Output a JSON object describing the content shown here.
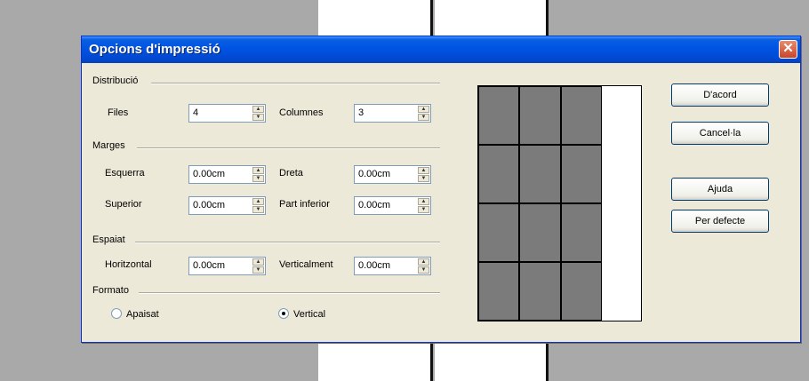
{
  "dialog": {
    "title": "Opcions d'impressió",
    "close_label": "✕"
  },
  "groups": {
    "distribucio": {
      "label": "Distribució",
      "files": {
        "label": "Files",
        "value": "4"
      },
      "columnes": {
        "label": "Columnes",
        "value": "3"
      }
    },
    "marges": {
      "label": "Marges",
      "esquerra": {
        "label": "Esquerra",
        "value": "0.00cm"
      },
      "dreta": {
        "label": "Dreta",
        "value": "0.00cm"
      },
      "superior": {
        "label": "Superior",
        "value": "0.00cm"
      },
      "part_inferior": {
        "label": "Part inferior",
        "value": "0.00cm"
      }
    },
    "espaiat": {
      "label": "Espaiat",
      "horitzontal": {
        "label": "Horitzontal",
        "value": "0.00cm"
      },
      "verticalment": {
        "label": "Verticalment",
        "value": "0.00cm"
      }
    },
    "formato": {
      "label": "Formato",
      "apaisat": {
        "label": "Apaisat",
        "selected": false
      },
      "vertical": {
        "label": "Vertical",
        "selected": true
      }
    }
  },
  "preview": {
    "rows": 4,
    "columns": 3
  },
  "buttons": {
    "dacord": "D'acord",
    "cancella": "Cancel·la",
    "ajuda": "Ajuda",
    "per_defecte": "Per defecte"
  },
  "icons": {
    "spin_up": "▲",
    "spin_down": "▼"
  },
  "colors": {
    "titlebar": "#0055e5",
    "dialog_bg": "#ece9d8",
    "close": "#c7452b",
    "preview_cell": "#7b7b7b"
  }
}
